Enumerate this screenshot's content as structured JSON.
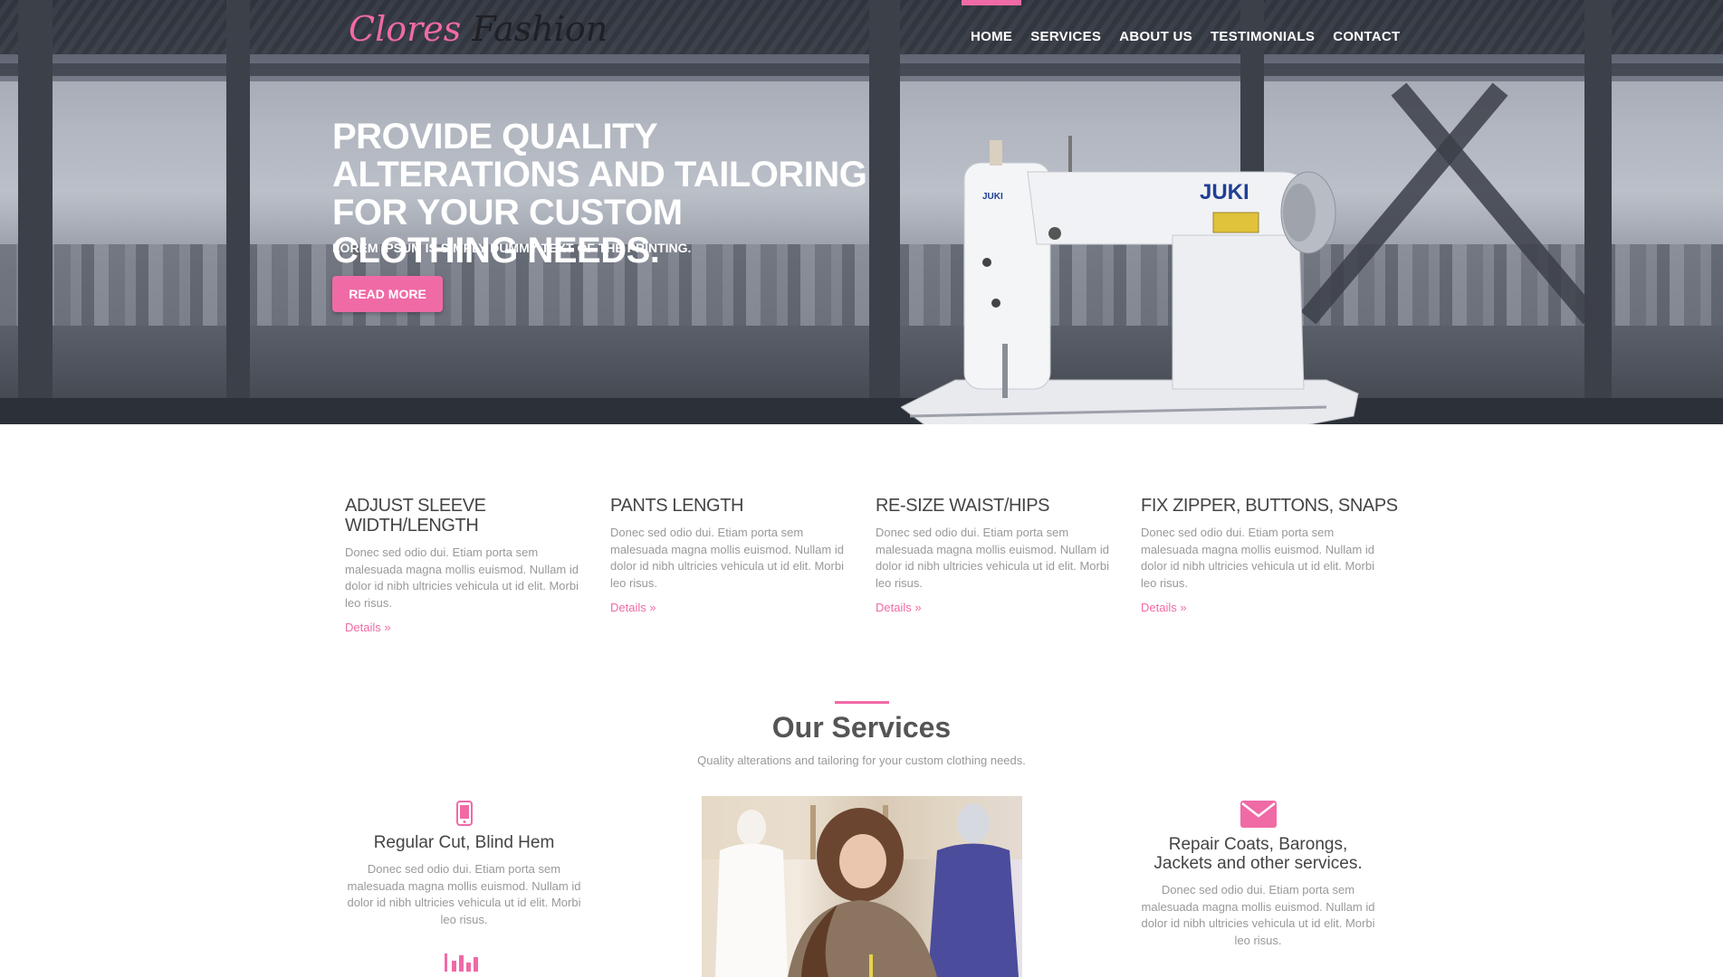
{
  "brand": {
    "part1": "Clores",
    "part2": "Fashion"
  },
  "nav": {
    "items": [
      {
        "label": "HOME",
        "active": true
      },
      {
        "label": "SERVICES",
        "active": false
      },
      {
        "label": "ABOUT US",
        "active": false
      },
      {
        "label": "TESTIMONIALS",
        "active": false
      },
      {
        "label": "CONTACT",
        "active": false
      }
    ]
  },
  "hero": {
    "title": "PROVIDE QUALITY ALTERATIONS AND TAILORING FOR YOUR CUSTOM CLOTHING NEEDS.",
    "subtitle": "LOREM IPSUM IS SIMPLY DUMMY TEXT OF THE PRINTING.",
    "button": "READ MORE",
    "machine_brand": "JUKI"
  },
  "features": [
    {
      "title": "ADJUST SLEEVE WIDTH/LENGTH",
      "text": "Donec sed odio dui. Etiam porta sem malesuada magna mollis euismod. Nullam id dolor id nibh ultricies vehicula ut id elit. Morbi leo risus.",
      "link": "Details »"
    },
    {
      "title": "PANTS LENGTH",
      "text": "Donec sed odio dui. Etiam porta sem malesuada magna mollis euismod. Nullam id dolor id nibh ultricies vehicula ut id elit. Morbi leo risus.",
      "link": "Details »"
    },
    {
      "title": "RE-SIZE WAIST/HIPS",
      "text": "Donec sed odio dui. Etiam porta sem malesuada magna mollis euismod. Nullam id dolor id nibh ultricies vehicula ut id elit. Morbi leo risus.",
      "link": "Details »"
    },
    {
      "title": "FIX ZIPPER, BUTTONS, SNAPS",
      "text": "Donec sed odio dui. Etiam porta sem malesuada magna mollis euismod. Nullam id dolor id nibh ultricies vehicula ut id elit. Morbi leo risus.",
      "link": "Details »"
    }
  ],
  "services": {
    "title": "Our Services",
    "subtitle": "Quality alterations and tailoring for your custom clothing needs.",
    "left": {
      "icon": "mobile-phone-icon",
      "title": "Regular Cut, Blind Hem",
      "text": "Donec sed odio dui. Etiam porta sem malesuada magna mollis euismod. Nullam id dolor id nibh ultricies vehicula ut id elit. Morbi leo risus.",
      "next_icon": "bar-chart-icon"
    },
    "right": {
      "icon": "envelope-icon",
      "title": "Repair Coats, Barongs, Jackets and other services.",
      "text": "Donec sed odio dui. Etiam porta sem malesuada magna mollis euismod. Nullam id dolor id nibh ultricies vehicula ut id elit. Morbi leo risus."
    }
  },
  "colors": {
    "accent": "#f06aa6",
    "heading": "#444444",
    "body_text": "#999999"
  }
}
